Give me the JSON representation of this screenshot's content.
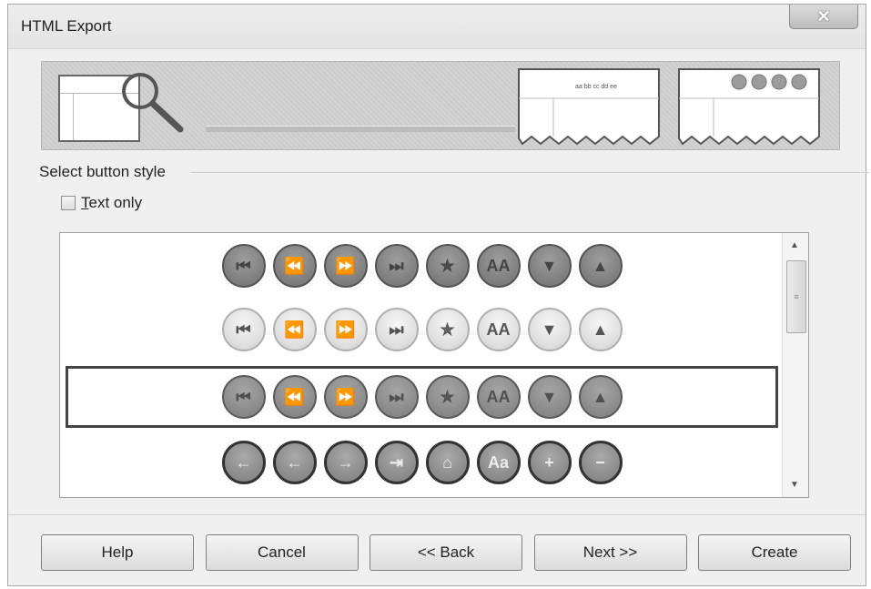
{
  "window": {
    "title": "HTML Export",
    "close_label": "✕"
  },
  "banner": {
    "preview_text": "aa bb cc dd ee"
  },
  "section": {
    "label": "Select button style"
  },
  "text_only": {
    "label": "Text only",
    "checked": false
  },
  "button_styles": [
    {
      "id": "style1",
      "glyphs": [
        "⏮",
        "⏪",
        "⏩",
        "⏭",
        "✯",
        "AA",
        "▼",
        "▲"
      ]
    },
    {
      "id": "style2",
      "glyphs": [
        "⏮",
        "⏪",
        "⏩",
        "⏭",
        "✯",
        "AA",
        "▼",
        "▲"
      ]
    },
    {
      "id": "style3",
      "glyphs": [
        "⏮",
        "⏪",
        "⏩",
        "⏭",
        "✯",
        "AA",
        "▼",
        "▲"
      ],
      "selected": true
    },
    {
      "id": "style4",
      "glyphs": [
        "←",
        "←",
        "→",
        "⇥",
        "⌂",
        "Aa",
        "+",
        "−"
      ]
    }
  ],
  "scrollbar": {
    "up": "▲",
    "down": "▼",
    "grip": "≡"
  },
  "footer": {
    "help": "Help",
    "cancel": "Cancel",
    "back": "<< Back",
    "next": "Next >>",
    "create": "Create"
  },
  "colors": {
    "dialog_bg": "#f0f0f0",
    "list_bg": "#ffffff",
    "selection_border": "#444444"
  }
}
